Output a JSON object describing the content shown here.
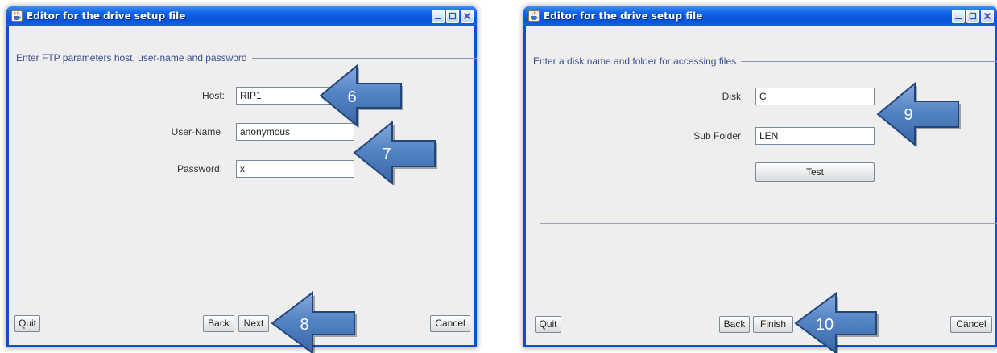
{
  "left_window": {
    "title": "Editor for the drive setup file",
    "section_heading": "Enter FTP parameters host, user-name and password",
    "fields": [
      {
        "label": "Host:",
        "value": "RIP1"
      },
      {
        "label": "User-Name",
        "value": "anonymous"
      },
      {
        "label": "Password:",
        "value": "x"
      }
    ],
    "buttons": {
      "quit": "Quit",
      "back": "Back",
      "next": "Next",
      "cancel": "Cancel"
    }
  },
  "right_window": {
    "title": "Editor for the drive setup file",
    "section_heading": "Enter a disk name and folder for accessing files",
    "fields": [
      {
        "label": "Disk",
        "value": "C"
      },
      {
        "label": "Sub Folder",
        "value": "LEN"
      }
    ],
    "test_button": "Test",
    "buttons": {
      "quit": "Quit",
      "back": "Back",
      "finish": "Finish",
      "cancel": "Cancel"
    }
  },
  "callouts": {
    "step6": "6",
    "step7": "7",
    "step8": "8",
    "step9": "9",
    "step10": "10"
  },
  "icons": {
    "app": "java-app-icon",
    "minimize": "minimize-icon",
    "maximize": "maximize-icon",
    "close": "close-icon",
    "callout": "left-arrow-callout"
  },
  "colors": {
    "title_bar": "#0855dc",
    "window_frame": "#0b4fd3",
    "section_heading": "#3b4f91",
    "callout_arrow": "#4f7fc0",
    "callout_outline": "#22457a"
  }
}
